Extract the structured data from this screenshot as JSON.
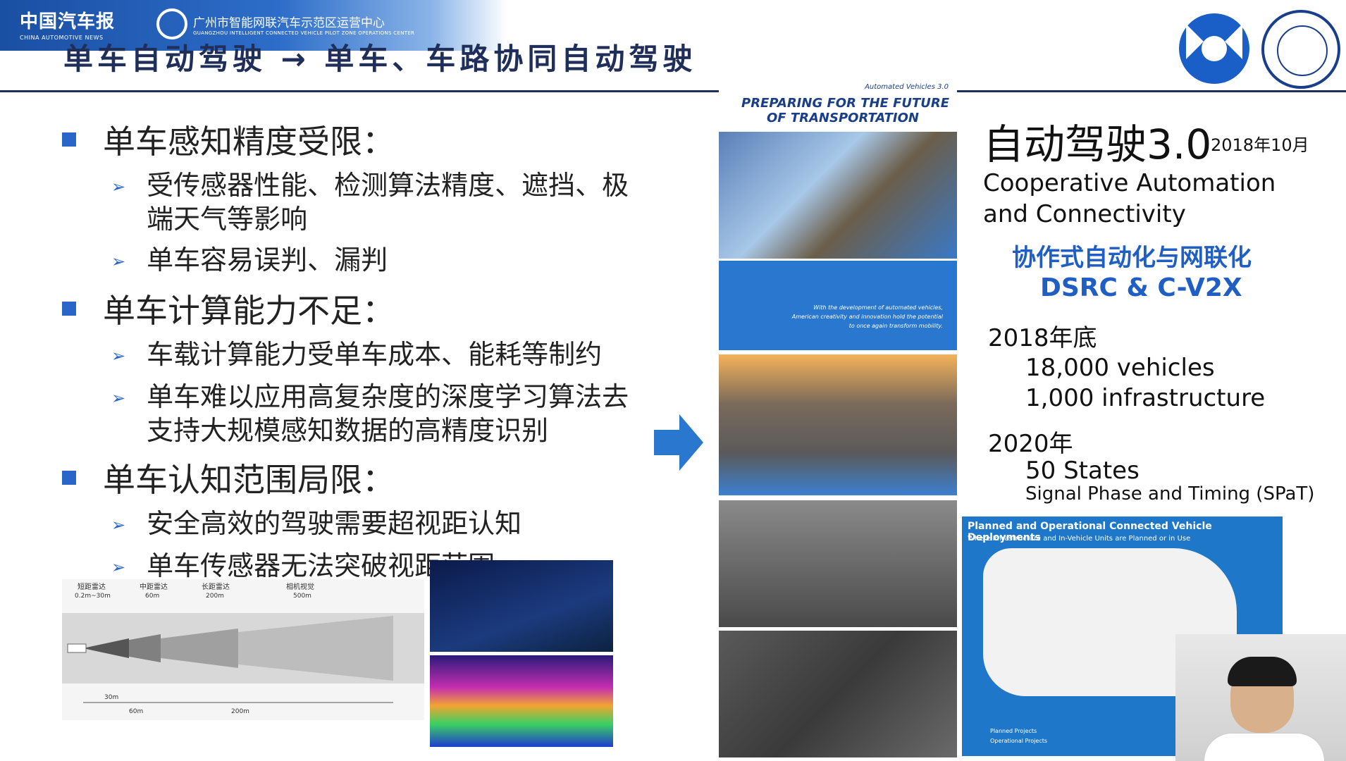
{
  "header": {
    "logo1_zh": "中国汽车报",
    "logo1_en": "CHINA AUTOMOTIVE NEWS",
    "logo2_zh": "广州市智能网联汽车示范区运营中心",
    "logo2_en": "GUANGZHOU INTELLIGENT CONNECTED VEHICLE PILOT ZONE OPERATIONS CENTER",
    "slide_title": "单车自动驾驶 → 单车、车路协同自动驾驶"
  },
  "left": {
    "sections": [
      {
        "heading": "单车感知精度受限：",
        "items": [
          "受传感器性能、检测算法精度、遮挡、极端天气等影响",
          "单车容易误判、漏判"
        ]
      },
      {
        "heading": "单车计算能力不足：",
        "items": [
          "车载计算能力受单车成本、能耗等制约",
          "单车难以应用高复杂度的深度学习算法去支持大规模感知数据的高精度识别"
        ]
      },
      {
        "heading": "单车认知范围局限：",
        "items": [
          "安全高效的驾驶需要超视距认知",
          "单车传感器无法突破视距范围"
        ]
      }
    ],
    "diagram_labels": [
      "短距雷达",
      "0.2m~30m",
      "中距雷达",
      "60m",
      "长距雷达",
      "200m",
      "相机视觉",
      "500m",
      "30m",
      "60m",
      "200m"
    ]
  },
  "cover": {
    "small_title": "Automated Vehicles 3.0",
    "title_line1": "PREPARING FOR THE FUTURE",
    "title_line2": "OF TRANSPORTATION",
    "blurb": "With the development of automated vehicles, American creativity and innovation hold the potential to once again transform mobility."
  },
  "map": {
    "title": "Planned and Operational Connected Vehicle Deployments",
    "subtitle": "Where Infrastructure and In-Vehicle Units are Planned or in Use",
    "legend": [
      "Planned Projects",
      "Operational Projects"
    ]
  },
  "right": {
    "ad30": "自动驾驶3.0",
    "date": "2018年10月",
    "coop_en": "Cooperative Automation and Connectivity",
    "coop_zh": "协作式自动化与网联化",
    "dsrc": "DSRC & C-V2X",
    "y2018": "2018年底",
    "vehicles": "18,000 vehicles",
    "infra": "1,000 infrastructure",
    "y2020": "2020年",
    "states": "50 States",
    "spat": "Signal Phase and Timing (SPaT)"
  },
  "colors": {
    "accent": "#2a66c7",
    "title": "#1f2f5a",
    "highlight": "#1f5fc4"
  }
}
